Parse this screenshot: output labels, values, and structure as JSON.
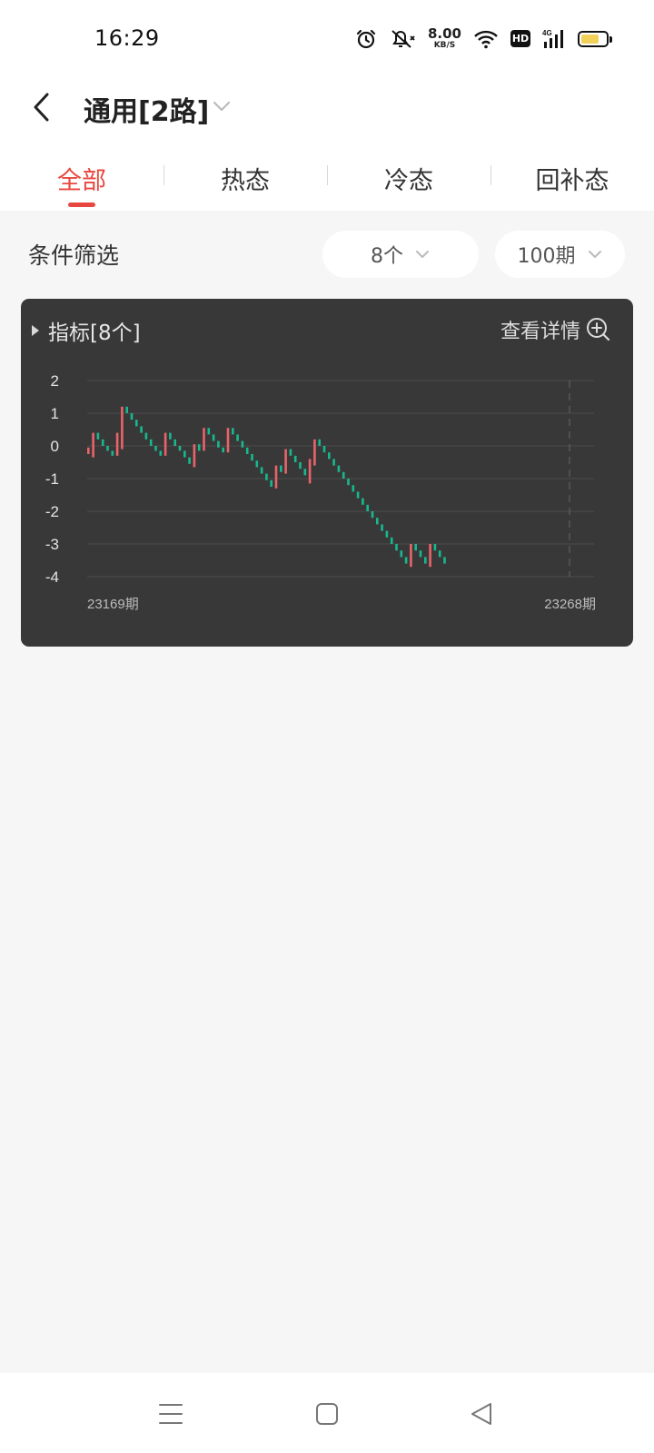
{
  "status": {
    "time": "16:29",
    "net_speed_value": "8.00",
    "net_speed_unit": "KB/S",
    "hd_label": "HD",
    "signal_label": "4G",
    "icons": [
      "alarm-icon",
      "mute-icon",
      "wifi-icon",
      "hd-icon",
      "signal-icon",
      "battery-icon"
    ],
    "battery_level": 0.6,
    "battery_color": "#f2d15b"
  },
  "header": {
    "title": "通用[2路]"
  },
  "tabs": [
    {
      "label": "全部",
      "active": true
    },
    {
      "label": "热态",
      "active": false
    },
    {
      "label": "冷态",
      "active": false
    },
    {
      "label": "回补态",
      "active": false
    }
  ],
  "filter": {
    "label": "条件筛选",
    "count_value": "8个",
    "period_value": "100期"
  },
  "card": {
    "title": "指标[8个]",
    "details_label": "查看详情"
  },
  "accent_color": "#e8473f",
  "chart_data": {
    "type": "candlestick",
    "y_ticks": [
      "2",
      "1",
      "0",
      "-1",
      "-2",
      "-3",
      "-4"
    ],
    "ylim": [
      -4,
      2
    ],
    "x_start_label": "23169期",
    "x_end_label": "23268期",
    "up_color": "#e8646a",
    "down_color": "#17b890",
    "grid": true,
    "candles": [
      [
        -0.25,
        -0.05
      ],
      [
        -0.35,
        0.4
      ],
      [
        0.4,
        0.2
      ],
      [
        0.2,
        0.0
      ],
      [
        0.0,
        -0.15
      ],
      [
        -0.15,
        -0.3
      ],
      [
        -0.3,
        0.4
      ],
      [
        -0.1,
        1.2
      ],
      [
        1.2,
        1.0
      ],
      [
        1.0,
        0.8
      ],
      [
        0.8,
        0.6
      ],
      [
        0.6,
        0.4
      ],
      [
        0.4,
        0.2
      ],
      [
        0.2,
        0.0
      ],
      [
        0.0,
        -0.15
      ],
      [
        -0.15,
        -0.3
      ],
      [
        -0.3,
        0.4
      ],
      [
        0.4,
        0.2
      ],
      [
        0.2,
        0.0
      ],
      [
        0.0,
        -0.15
      ],
      [
        -0.15,
        -0.35
      ],
      [
        -0.35,
        -0.55
      ],
      [
        -0.65,
        0.05
      ],
      [
        0.05,
        -0.15
      ],
      [
        -0.15,
        0.55
      ],
      [
        0.55,
        0.35
      ],
      [
        0.35,
        0.15
      ],
      [
        0.15,
        -0.05
      ],
      [
        -0.05,
        -0.2
      ],
      [
        -0.2,
        0.55
      ],
      [
        0.55,
        0.35
      ],
      [
        0.35,
        0.15
      ],
      [
        0.15,
        -0.05
      ],
      [
        -0.05,
        -0.25
      ],
      [
        -0.25,
        -0.45
      ],
      [
        -0.45,
        -0.65
      ],
      [
        -0.65,
        -0.85
      ],
      [
        -0.85,
        -1.05
      ],
      [
        -1.05,
        -1.25
      ],
      [
        -1.3,
        -0.6
      ],
      [
        -0.6,
        -0.8
      ],
      [
        -0.85,
        -0.1
      ],
      [
        -0.1,
        -0.3
      ],
      [
        -0.3,
        -0.5
      ],
      [
        -0.5,
        -0.7
      ],
      [
        -0.7,
        -0.9
      ],
      [
        -1.15,
        -0.4
      ],
      [
        -0.6,
        0.2
      ],
      [
        0.2,
        0.0
      ],
      [
        0.0,
        -0.2
      ],
      [
        -0.2,
        -0.4
      ],
      [
        -0.4,
        -0.6
      ],
      [
        -0.6,
        -0.8
      ],
      [
        -0.8,
        -1.0
      ],
      [
        -1.0,
        -1.2
      ],
      [
        -1.2,
        -1.4
      ],
      [
        -1.4,
        -1.6
      ],
      [
        -1.6,
        -1.8
      ],
      [
        -1.8,
        -2.0
      ],
      [
        -2.0,
        -2.2
      ],
      [
        -2.2,
        -2.4
      ],
      [
        -2.4,
        -2.6
      ],
      [
        -2.6,
        -2.8
      ],
      [
        -2.8,
        -3.0
      ],
      [
        -3.0,
        -3.2
      ],
      [
        -3.2,
        -3.4
      ],
      [
        -3.4,
        -3.6
      ],
      [
        -3.7,
        -3.0
      ],
      [
        -3.0,
        -3.2
      ],
      [
        -3.2,
        -3.4
      ],
      [
        -3.4,
        -3.6
      ],
      [
        -3.7,
        -3.0
      ],
      [
        -3.0,
        -3.2
      ],
      [
        -3.2,
        -3.4
      ],
      [
        -3.4,
        -3.6
      ]
    ]
  },
  "navbar": {
    "icons": [
      "menu-icon",
      "home-icon",
      "back-triangle-icon"
    ]
  }
}
